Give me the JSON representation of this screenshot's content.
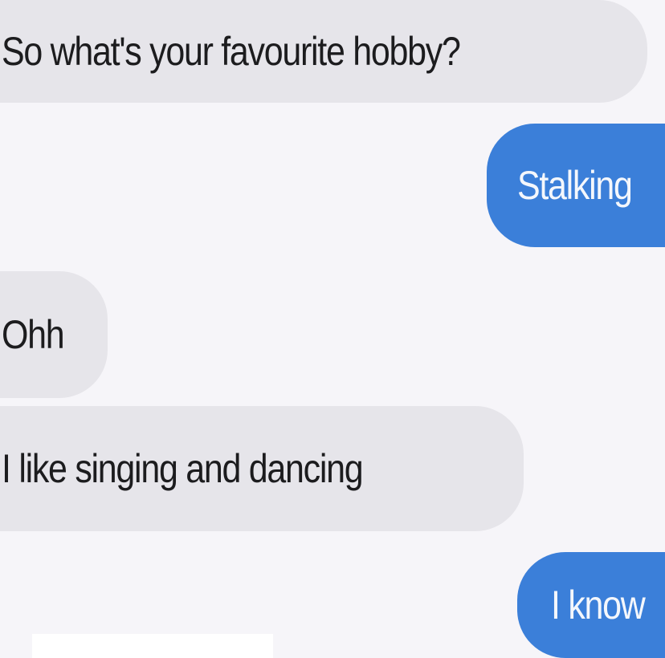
{
  "conversation": {
    "messages": [
      {
        "sender": "received",
        "text": "So what's your favourite hobby?"
      },
      {
        "sender": "sent",
        "text": "Stalking"
      },
      {
        "sender": "received",
        "text": "Ohh"
      },
      {
        "sender": "received",
        "text": "I like singing and dancing"
      },
      {
        "sender": "sent",
        "text": "I know"
      }
    ]
  },
  "colors": {
    "background": "#f6f5f9",
    "received_bubble": "#e6e5ea",
    "sent_bubble": "#3b7fd9",
    "received_text": "#1c1c1e",
    "sent_text": "#f4f7fc"
  }
}
